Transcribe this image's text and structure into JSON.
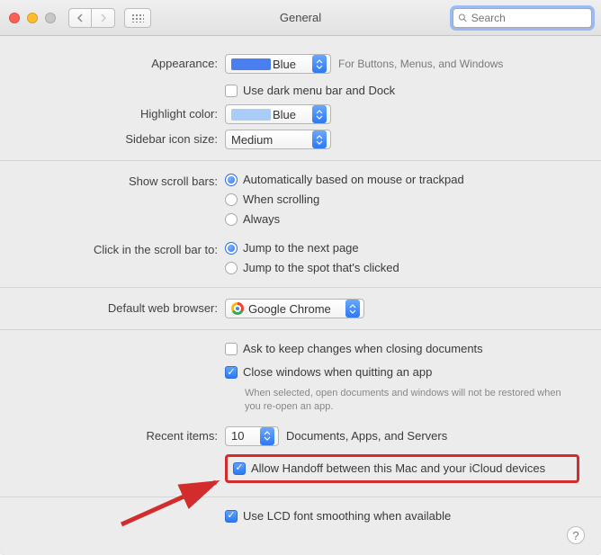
{
  "window": {
    "title": "General"
  },
  "search": {
    "placeholder": "Search"
  },
  "labels": {
    "appearance": "Appearance:",
    "highlight": "Highlight color:",
    "sidebar": "Sidebar icon size:",
    "scrollbars": "Show scroll bars:",
    "clickscroll": "Click in the scroll bar to:",
    "browser": "Default web browser:",
    "recent": "Recent items:"
  },
  "appearance": {
    "value": "Blue",
    "hint": "For Buttons, Menus, and Windows",
    "darkmenu_checked": false,
    "darkmenu_label": "Use dark menu bar and Dock"
  },
  "highlight": {
    "value": "Blue"
  },
  "sidebar": {
    "value": "Medium"
  },
  "scrollbars": {
    "options": [
      "Automatically based on mouse or trackpad",
      "When scrolling",
      "Always"
    ],
    "selected_index": 0
  },
  "clickscroll": {
    "options": [
      "Jump to the next page",
      "Jump to the spot that's clicked"
    ],
    "selected_index": 0
  },
  "browser": {
    "value": "Google Chrome"
  },
  "docs": {
    "ask_label": "Ask to keep changes when closing documents",
    "ask_checked": false,
    "close_label": "Close windows when quitting an app",
    "close_checked": true,
    "close_hint": "When selected, open documents and windows will not be restored when you re-open an app."
  },
  "recent": {
    "value": "10",
    "suffix": "Documents, Apps, and Servers"
  },
  "handoff": {
    "label": "Allow Handoff between this Mac and your iCloud devices",
    "checked": true
  },
  "lcd": {
    "label": "Use LCD font smoothing when available",
    "checked": true
  },
  "help": "?"
}
